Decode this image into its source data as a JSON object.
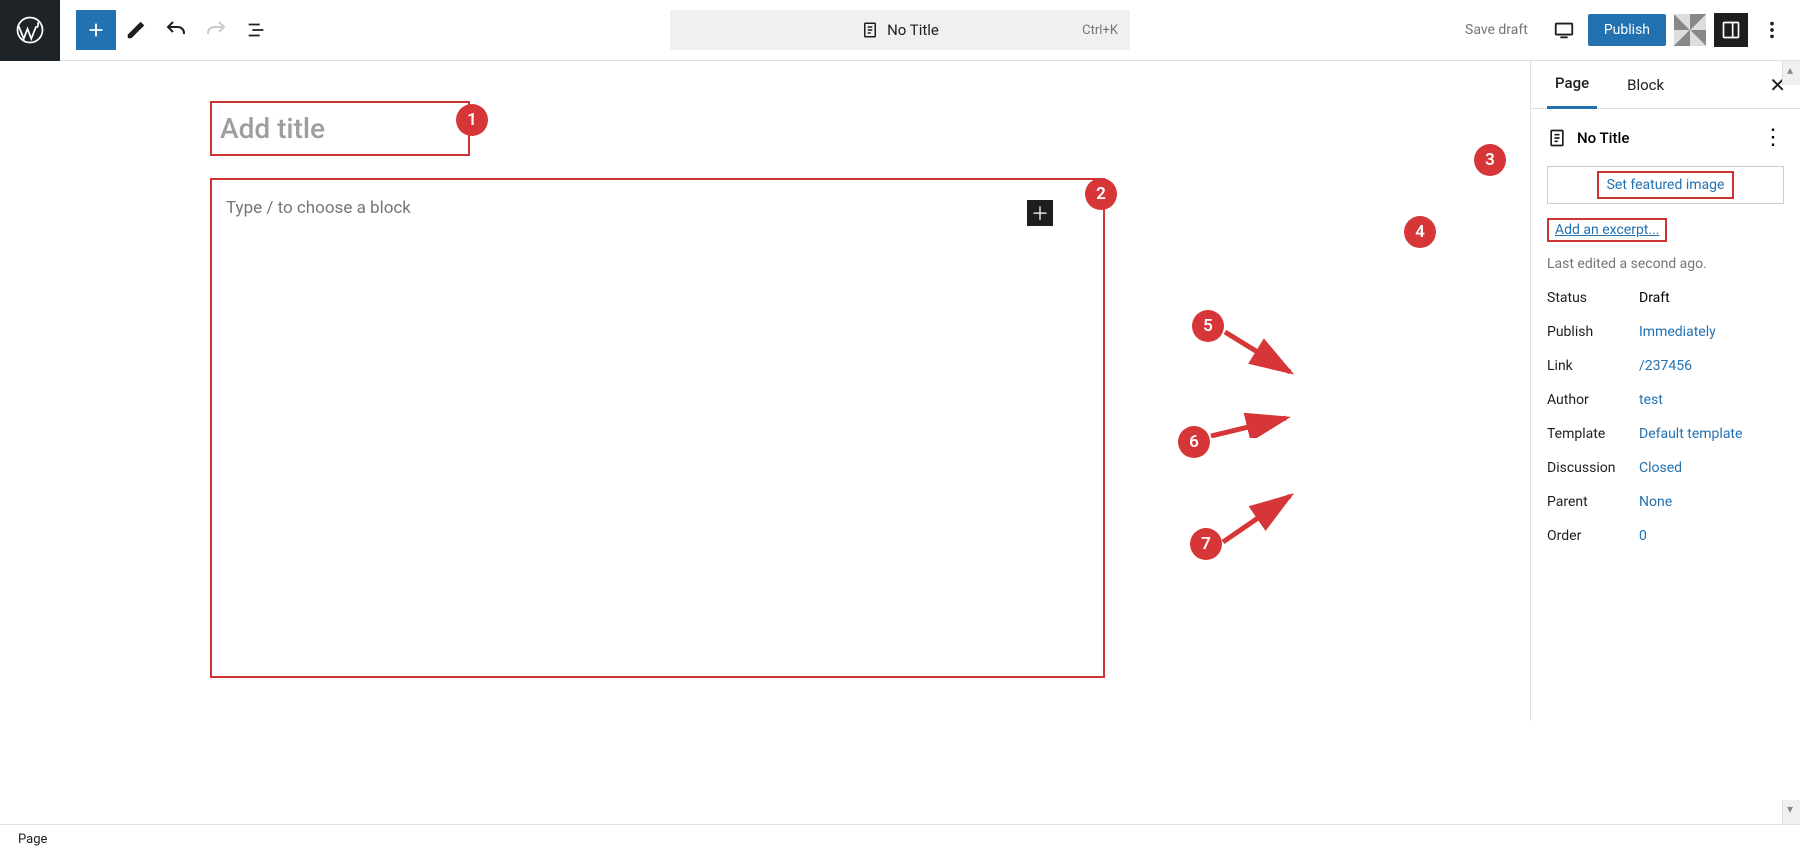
{
  "topbar": {
    "command_title": "No Title",
    "shortcut": "Ctrl+K",
    "save_draft_label": "Save draft",
    "publish_label": "Publish"
  },
  "editor": {
    "title_placeholder": "Add title",
    "content_placeholder": "Type / to choose a block"
  },
  "sidebar": {
    "tabs": {
      "page": "Page",
      "block": "Block"
    },
    "doc_title": "No Title",
    "featured_image_label": "Set featured image",
    "add_excerpt_label": "Add an excerpt...",
    "last_edited": "Last edited a second ago.",
    "meta": [
      {
        "label": "Status",
        "value": "Draft",
        "link": false
      },
      {
        "label": "Publish",
        "value": "Immediately",
        "link": true
      },
      {
        "label": "Link",
        "value": "/237456",
        "link": true
      },
      {
        "label": "Author",
        "value": "test",
        "link": true
      },
      {
        "label": "Template",
        "value": "Default template",
        "link": true
      },
      {
        "label": "Discussion",
        "value": "Closed",
        "link": true
      },
      {
        "label": "Parent",
        "value": "None",
        "link": true
      },
      {
        "label": "Order",
        "value": "0",
        "link": true
      }
    ]
  },
  "footer": {
    "breadcrumb": "Page"
  },
  "annotations": {
    "badge1": "1",
    "badge2": "2",
    "badge3": "3",
    "badge4": "4",
    "badge5": "5",
    "badge6": "6",
    "badge7": "7"
  }
}
